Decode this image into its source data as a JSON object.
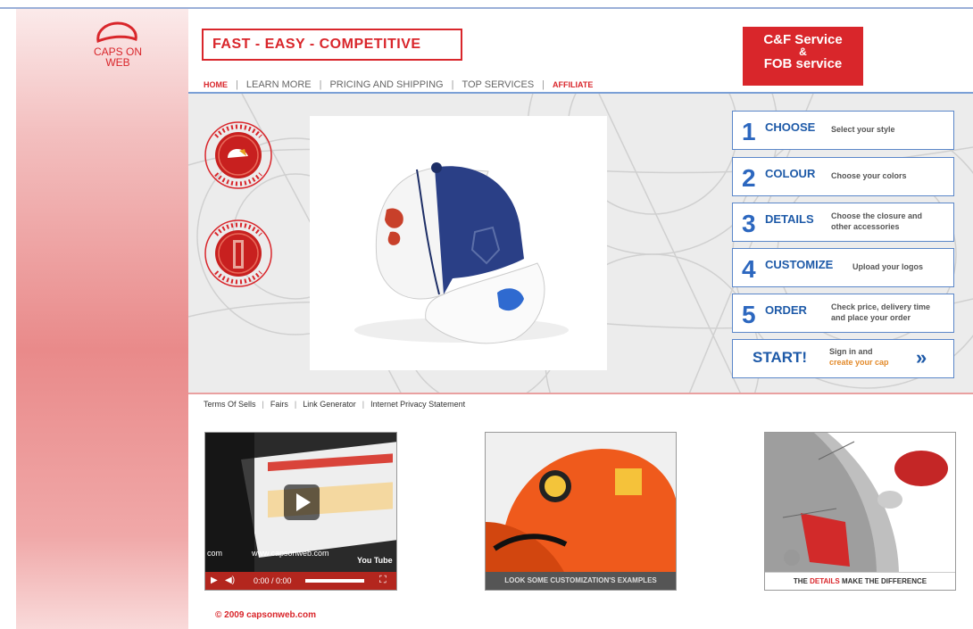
{
  "brand": {
    "logo_line1": "CAPS ON",
    "logo_line2": "WEB"
  },
  "slogan": "FAST - EASY - COMPETITIVE",
  "nav": [
    "HOME",
    "LEARN MORE",
    "PRICING AND SHIPPING",
    "TOP SERVICES",
    "AFFILIATE"
  ],
  "badge": {
    "line1": "C&F Service",
    "line2": "&",
    "line3": "FOB service"
  },
  "steps": [
    {
      "num": "1",
      "title": "CHOOSE",
      "desc1": "Select your style",
      "desc2": ""
    },
    {
      "num": "2",
      "title": "COLOUR",
      "desc1": "Choose your colors",
      "desc2": ""
    },
    {
      "num": "3",
      "title": "DETAILS",
      "desc1": "Choose the closure and",
      "desc2": "other accessories"
    },
    {
      "num": "4",
      "title": "CUSTOMIZE",
      "desc1": "Upload your logos",
      "desc2": ""
    },
    {
      "num": "5",
      "title": "ORDER",
      "desc1": "Check price, delivery time",
      "desc2": "and place your order"
    }
  ],
  "start": {
    "label": "START!",
    "line1": "Sign in and",
    "line2": "create your cap"
  },
  "seals": {
    "top_text": "TOP QUALITY CAP",
    "bottom_text": "TOP QUALITY EMBROIDERY"
  },
  "footer_links": [
    "Terms Of Sells",
    "Fairs",
    "Link Generator",
    "Internet Privacy Statement"
  ],
  "video": {
    "url": "www.capsonweb.com",
    "com": "com",
    "time": "0:00 / 0:00",
    "yt": "You Tube"
  },
  "thumb2_caption": "LOOK SOME CUSTOMIZATION'S EXAMPLES",
  "thumb3_caption": {
    "pre": "THE ",
    "highlight": "DETAILS",
    "post": " MAKE THE DIFFERENCE"
  },
  "copyright": "© 2009 capsonweb.com",
  "colors": {
    "brand_red": "#d9262b",
    "step_blue": "#1e5aa8"
  }
}
